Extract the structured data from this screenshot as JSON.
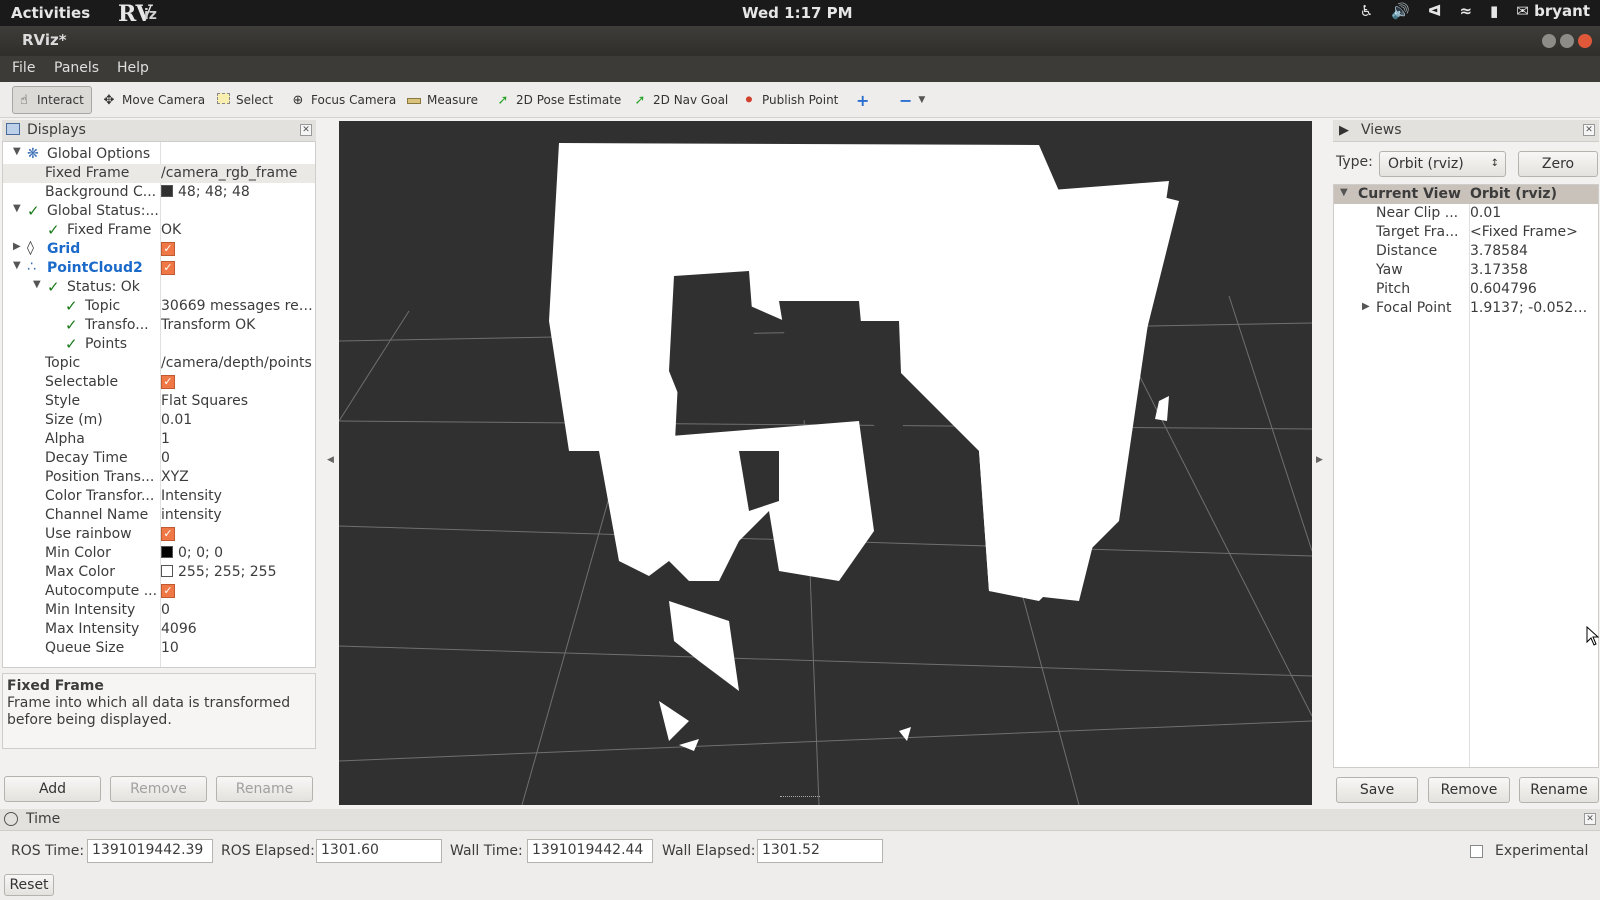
{
  "topbar": {
    "activities": "Activities",
    "clock": "Wed  1:17 PM",
    "user": "bryant"
  },
  "window": {
    "title": "RViz*"
  },
  "menu": [
    "File",
    "Panels",
    "Help"
  ],
  "toolbar": [
    {
      "label": "Interact",
      "icon": "hand-icon"
    },
    {
      "label": "Move Camera",
      "icon": "move-icon"
    },
    {
      "label": "Select",
      "icon": "select-icon"
    },
    {
      "label": "Focus Camera",
      "icon": "focus-icon"
    },
    {
      "label": "Measure",
      "icon": "ruler-icon"
    },
    {
      "label": "2D Pose Estimate",
      "icon": "arrow-icon"
    },
    {
      "label": "2D Nav Goal",
      "icon": "arrow-icon"
    },
    {
      "label": "Publish Point",
      "icon": "pin-icon"
    }
  ],
  "displays": {
    "title": "Displays",
    "rows": [
      {
        "key": "Global Options",
        "value": ""
      },
      {
        "key": "Fixed Frame",
        "value": "/camera_rgb_frame"
      },
      {
        "key": "Background C...",
        "value": "48; 48; 48"
      },
      {
        "key": "Global Status:...",
        "value": ""
      },
      {
        "key": "Fixed Frame",
        "value": "OK"
      },
      {
        "key": "Grid",
        "value": ""
      },
      {
        "key": "PointCloud2",
        "value": ""
      },
      {
        "key": "Status: Ok",
        "value": ""
      },
      {
        "key": "Topic",
        "value": "30669 messages rec..."
      },
      {
        "key": "Transfo...",
        "value": "Transform OK"
      },
      {
        "key": "Points",
        "value": ""
      },
      {
        "key": "Topic",
        "value": "/camera/depth/points"
      },
      {
        "key": "Selectable",
        "value": ""
      },
      {
        "key": "Style",
        "value": "Flat Squares"
      },
      {
        "key": "Size (m)",
        "value": "0.01"
      },
      {
        "key": "Alpha",
        "value": "1"
      },
      {
        "key": "Decay Time",
        "value": "0"
      },
      {
        "key": "Position Trans...",
        "value": "XYZ"
      },
      {
        "key": "Color Transfor...",
        "value": "Intensity"
      },
      {
        "key": "Channel Name",
        "value": "intensity"
      },
      {
        "key": "Use rainbow",
        "value": ""
      },
      {
        "key": "Min Color",
        "value": "0; 0; 0"
      },
      {
        "key": "Max Color",
        "value": "255; 255; 255"
      },
      {
        "key": "Autocompute ...",
        "value": ""
      },
      {
        "key": "Min Intensity",
        "value": "0"
      },
      {
        "key": "Max Intensity",
        "value": "4096"
      },
      {
        "key": "Queue Size",
        "value": "10"
      }
    ],
    "desc_title": "Fixed Frame",
    "desc_text": "Frame into which all data is transformed before being displayed.",
    "buttons": {
      "add": "Add",
      "remove": "Remove",
      "rename": "Rename"
    }
  },
  "views": {
    "title": "Views",
    "type_label": "Type:",
    "type_value": "Orbit (rviz)",
    "zero": "Zero",
    "header": {
      "key": "Current View",
      "value": "Orbit (rviz)"
    },
    "rows": [
      {
        "key": "Near Clip ...",
        "value": "0.01"
      },
      {
        "key": "Target Fra...",
        "value": "<Fixed Frame>"
      },
      {
        "key": "Distance",
        "value": "3.78584"
      },
      {
        "key": "Yaw",
        "value": "3.17358"
      },
      {
        "key": "Pitch",
        "value": "0.604796"
      },
      {
        "key": "Focal Point",
        "value": "1.9137; -0.05202..."
      }
    ],
    "buttons": {
      "save": "Save",
      "remove": "Remove",
      "rename": "Rename"
    }
  },
  "time": {
    "title": "Time",
    "ros_time_label": "ROS Time:",
    "ros_time": "1391019442.39",
    "ros_elapsed_label": "ROS Elapsed:",
    "ros_elapsed": "1301.60",
    "wall_time_label": "Wall Time:",
    "wall_time": "1391019442.44",
    "wall_elapsed_label": "Wall Elapsed:",
    "wall_elapsed": "1301.52",
    "experimental": "Experimental",
    "reset": "Reset"
  },
  "colors": {
    "viewport_bg": "#303030",
    "checkbox": "#f07746"
  }
}
